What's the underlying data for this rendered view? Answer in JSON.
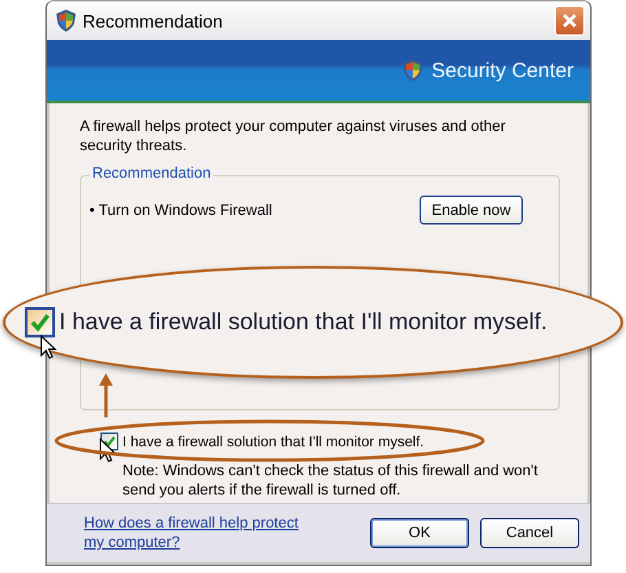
{
  "window": {
    "title": "Recommendation"
  },
  "banner": {
    "title": "Security Center"
  },
  "intro": "A firewall helps protect your computer against viruses and other security threats.",
  "recommendation": {
    "legend": "Recommendation",
    "items": [
      {
        "text": "• Turn on Windows Firewall",
        "button": "Enable now"
      }
    ]
  },
  "monitor_option": {
    "label": "I have a firewall solution that I'll monitor myself.",
    "checked": true,
    "note": "Note: Windows can't check the status of this firewall and won't send you alerts if the firewall is turned off."
  },
  "callout": {
    "label": "I have a firewall solution that I'll monitor myself.",
    "checked": true
  },
  "help_link": "How does a firewall help protect my computer?",
  "buttons": [
    {
      "label": "OK",
      "default": true
    },
    {
      "label": "Cancel",
      "default": false
    }
  ]
}
